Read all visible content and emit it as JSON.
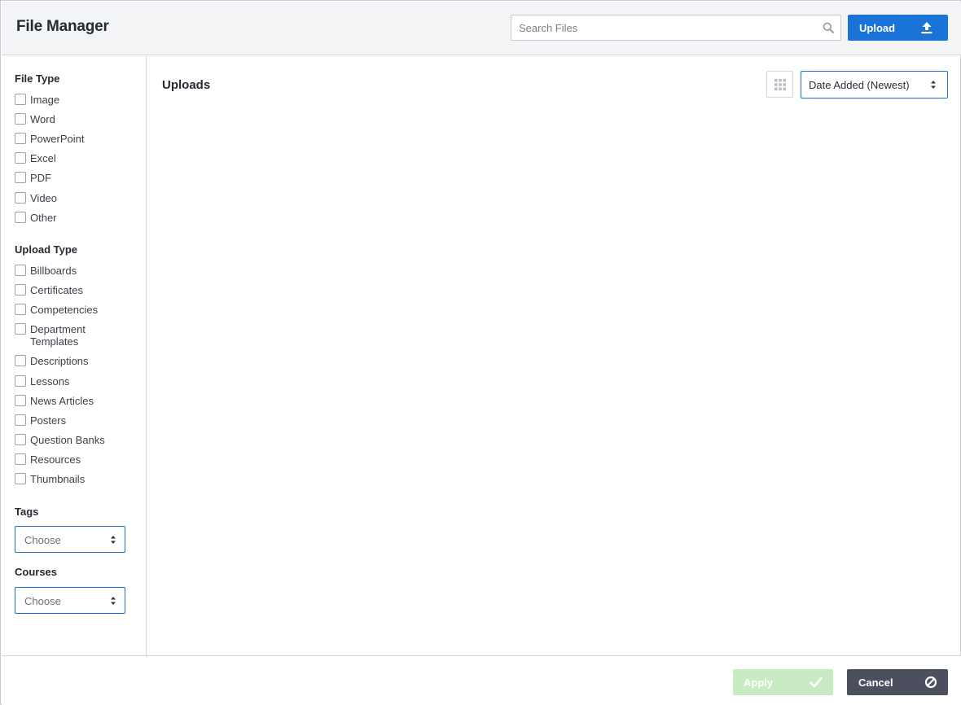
{
  "header": {
    "title": "File Manager",
    "search_placeholder": "Search Files",
    "search_value": "",
    "upload_label": "Upload"
  },
  "sidebar": {
    "file_type": {
      "title": "File Type",
      "items": [
        "Image",
        "Word",
        "PowerPoint",
        "Excel",
        "PDF",
        "Video",
        "Other"
      ]
    },
    "upload_type": {
      "title": "Upload Type",
      "items": [
        "Billboards",
        "Certificates",
        "Competencies",
        "Department Templates",
        "Descriptions",
        "Lessons",
        "News Articles",
        "Posters",
        "Question Banks",
        "Resources",
        "Thumbnails"
      ]
    },
    "tags": {
      "title": "Tags",
      "value": "Choose"
    },
    "courses": {
      "title": "Courses",
      "value": "Choose"
    }
  },
  "main": {
    "title": "Uploads",
    "sort_value": "Date Added (Newest)"
  },
  "footer": {
    "apply_label": "Apply",
    "cancel_label": "Cancel"
  },
  "colors": {
    "accent": "#1a73d6",
    "apply_disabled": "#c9ebc3",
    "cancel": "#4c4f5d",
    "header_bg": "#f3f4f6"
  },
  "icons": {
    "search": "search-icon",
    "upload": "upload-icon",
    "grid": "grid-icon",
    "caret": "sort-caret-icon",
    "apply": "check-icon",
    "cancel": "ban-icon"
  }
}
